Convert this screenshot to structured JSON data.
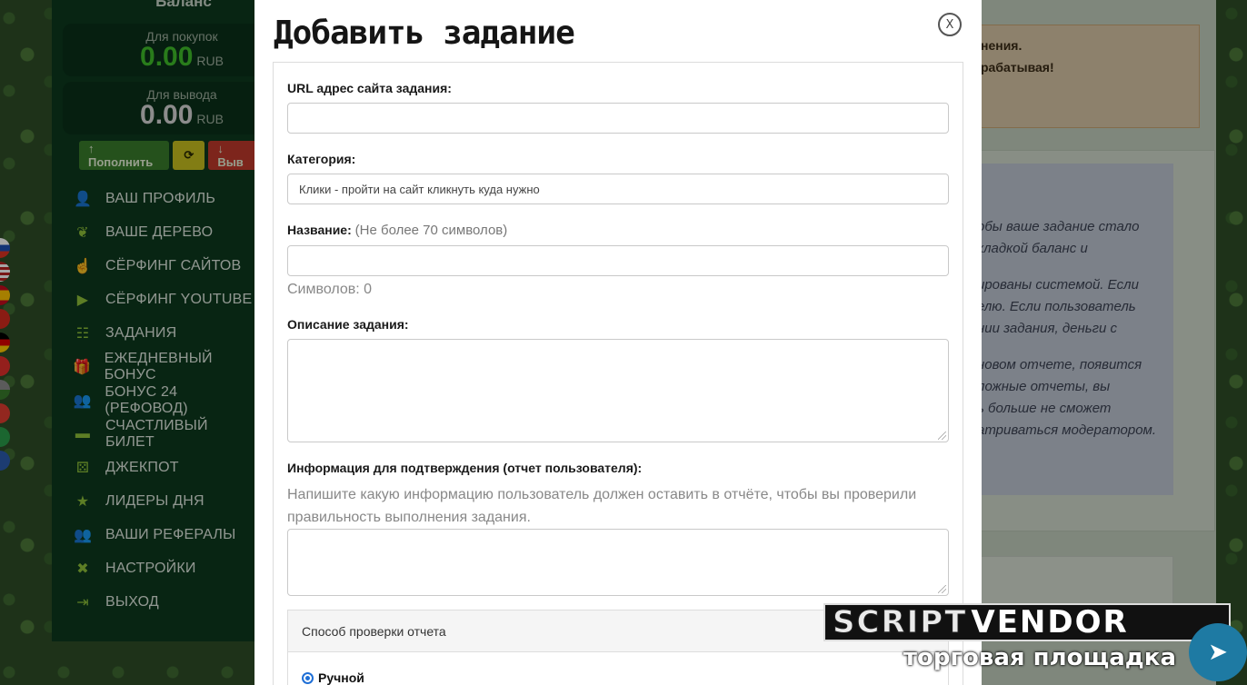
{
  "sidebar": {
    "balance_title": "Баланс",
    "buy_balance": {
      "label": "Для покупок",
      "value": "0.00",
      "currency": "RUB",
      "color": "#3fbf2a"
    },
    "withdraw_balance": {
      "label": "Для вывода",
      "value": "0.00",
      "currency": "RUB",
      "color": "#d8d8d8"
    },
    "buttons": {
      "topup": "↑ Пополнить",
      "refresh": "⟳",
      "withdraw": "↓ Выв"
    },
    "menu": [
      {
        "icon": "user-icon",
        "glyph": "👤",
        "label": "ВАШ ПРОФИЛЬ"
      },
      {
        "icon": "tree-icon",
        "glyph": "❦",
        "label": "ВАШЕ ДЕРЕВО"
      },
      {
        "icon": "pointer-hand-icon",
        "glyph": "☝",
        "label": "СЁРФИНГ САЙТОВ"
      },
      {
        "icon": "youtube-icon",
        "glyph": "▶",
        "label": "СЁРФИНГ YOUTUBE"
      },
      {
        "icon": "tasks-list-icon",
        "glyph": "☷",
        "label": "ЗАДАНИЯ"
      },
      {
        "icon": "gift-icon",
        "glyph": "🎁",
        "label": "ЕЖЕДНЕВНЫЙ БОНУС"
      },
      {
        "icon": "users-icon",
        "glyph": "👥",
        "label": "БОНУС 24 (РЕФОВОД)"
      },
      {
        "icon": "ticket-icon",
        "glyph": "▬",
        "label": "СЧАСТЛИВЫЙ БИЛЕТ"
      },
      {
        "icon": "dice-icon",
        "glyph": "⚄",
        "label": "ДЖЕКПОТ"
      },
      {
        "icon": "star-icon",
        "glyph": "★",
        "label": "ЛИДЕРЫ ДНЯ"
      },
      {
        "icon": "referrals-icon",
        "glyph": "👥",
        "label": "ВАШИ РЕФЕРАЛЫ"
      },
      {
        "icon": "tools-icon",
        "glyph": "✖",
        "label": "НАСТРОЙКИ"
      },
      {
        "icon": "logout-icon",
        "glyph": "⇥",
        "label": "ВЫХОД"
      }
    ]
  },
  "background_right": {
    "notice_lines": [
      "нения.",
      "рабатывая!"
    ],
    "info_paragraphs": [
      [
        "обы ваше задание стало",
        "кладкой баланс и"
      ],
      [
        "ированы системой. Если",
        "елю. Если пользователь",
        "нии задания, деньги с"
      ],
      [
        "новом отчете, появится",
        "ложные отчеты, вы",
        "ь больше не сможет",
        "атриваться модератором."
      ]
    ]
  },
  "modal": {
    "title": "Добавить задание",
    "close_label": "X",
    "url_label": "URL адрес сайта задания:",
    "url_value": "",
    "category_label": "Категория:",
    "category_value": "Клики - пройти на сайт кликнуть куда нужно",
    "name_label": "Название:",
    "name_hint": "(Не более 70 символов)",
    "name_value": "",
    "chars_counter": "Символов: 0",
    "description_label": "Описание задания:",
    "confirm_label": "Информация для подтверждения (отчет пользователя):",
    "confirm_help": "Напишите какую информацию пользователь должен оставить в отчёте, чтобы вы проверили правильность выполнения задания.",
    "check_method_title": "Способ проверки отчета",
    "check_option_manual": "Ручной"
  },
  "watermark": {
    "brand_part1": "SCRIPT",
    "brand_part2": "VENDOR",
    "subtitle": "торговая площадка"
  },
  "colors": {
    "sidebar_bg": "#0d3a1e",
    "topup_button": "#3a7d2c",
    "refresh_button": "#c8c020",
    "withdraw_button": "#c0392b",
    "menu_icon": "#8fc23a",
    "telegram": "#1e7aa3"
  }
}
